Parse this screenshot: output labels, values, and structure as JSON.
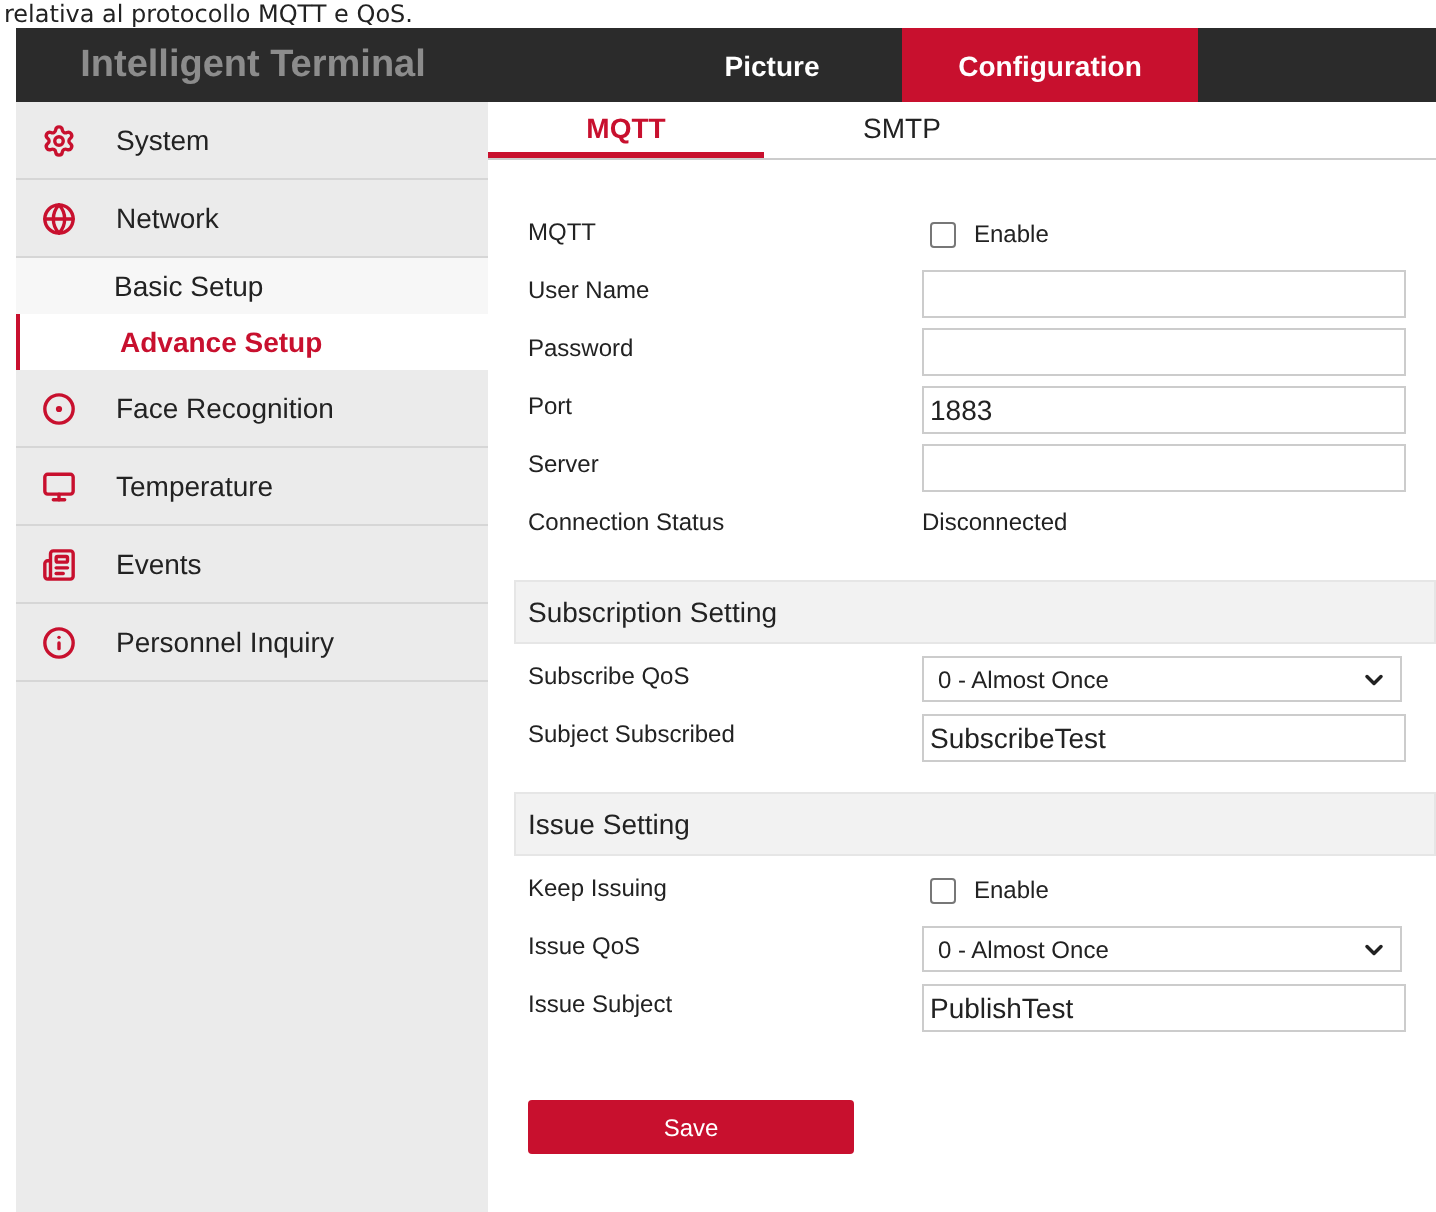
{
  "caption": "relativa al protocollo MQTT e QoS.",
  "header": {
    "title": "Intelligent Terminal",
    "tabs": [
      {
        "label": "Picture",
        "selected": false
      },
      {
        "label": "Configuration",
        "selected": true
      }
    ]
  },
  "sidebar": [
    {
      "label": "System"
    },
    {
      "label": "Network",
      "children": [
        {
          "label": "Basic Setup",
          "selected": false
        },
        {
          "label": "Advance Setup",
          "selected": true
        }
      ]
    },
    {
      "label": "Face Recognition"
    },
    {
      "label": "Temperature"
    },
    {
      "label": "Events"
    },
    {
      "label": "Personnel Inquiry"
    }
  ],
  "sub_tabs": [
    {
      "label": "MQTT",
      "selected": true
    },
    {
      "label": "SMTP",
      "selected": false
    }
  ],
  "sections": [
    {
      "fields": [
        {
          "kind": "checkbox",
          "label": "MQTT",
          "option": "Enable",
          "checked": false
        },
        {
          "kind": "input",
          "label": "User Name"
        },
        {
          "kind": "input",
          "label": "Password"
        },
        {
          "kind": "input",
          "label": "Port",
          "value": "1883"
        },
        {
          "kind": "input",
          "label": "Server"
        },
        {
          "kind": "status",
          "label": "Connection Status",
          "value": "Disconnected"
        }
      ]
    },
    {
      "heading": "Subscription Setting",
      "fields": [
        {
          "kind": "select",
          "label": "Subscribe QoS",
          "value": "0 - Almost Once"
        },
        {
          "kind": "input",
          "label": "Subject Subscribed",
          "value": "SubscribeTest"
        }
      ]
    },
    {
      "heading": "Issue Setting",
      "fields": [
        {
          "kind": "checkbox",
          "label": "Keep Issuing",
          "option": "Enable",
          "checked": false
        },
        {
          "kind": "select",
          "label": "Issue QoS",
          "value": "0 - Almost Once"
        },
        {
          "kind": "input",
          "label": "Issue Subject",
          "value": "PublishTest"
        }
      ]
    }
  ],
  "save_button": "Save"
}
